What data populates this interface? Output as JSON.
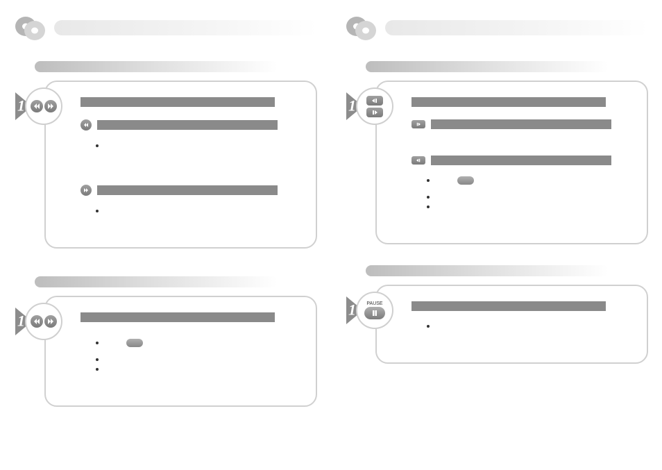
{
  "left": {
    "step_number": "1",
    "panel1": {},
    "panel2": {}
  },
  "right": {
    "step_number": "1",
    "pause_label": "PAUSE",
    "panel1": {},
    "panel2": {}
  }
}
